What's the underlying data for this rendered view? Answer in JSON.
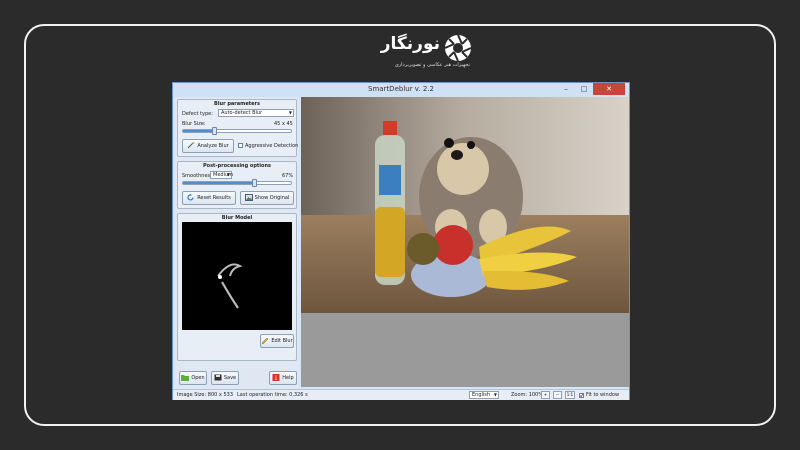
{
  "brand": {
    "name": "نورنگار",
    "tagline": "تجهیزات هنر عکاسی و تصویربرداری"
  },
  "window": {
    "title": "SmartDeblur v. 2.2",
    "min": "–",
    "max": "□",
    "close": "✕"
  },
  "blur_params": {
    "heading": "Blur parameters",
    "defect_type_label": "Defect type:",
    "defect_type_value": "Auto-detect Blur",
    "blur_size_label": "Blur Size:",
    "blur_size_value": "45 x 45",
    "blur_size_level": 0.3,
    "analyze_label": "Analyze Blur",
    "aggressive_label": "Aggressive Detection"
  },
  "post_processing": {
    "heading": "Post-processing options",
    "smoothness_label": "Smoothness:",
    "smoothness_value": "Medium",
    "smoothness_pct": "67%",
    "smoothness_level": 0.67,
    "reset_label": "Reset Results",
    "show_original_label": "Show Original"
  },
  "blur_model": {
    "heading": "Blur Model",
    "edit_label": "Edit Blur"
  },
  "bottom": {
    "open_label": "Open",
    "save_label": "Save",
    "help_label": "Help"
  },
  "status": {
    "image_size": "Image Size: 800 x 533",
    "last_operation": "Last operation time: 0,326 s",
    "language": "English",
    "zoom": "Zoom: 100%",
    "one_to_one": "1:1",
    "fit_label": "Fit to window"
  },
  "colors": {
    "accent": "#4a8fd8",
    "close": "#c7463b"
  }
}
